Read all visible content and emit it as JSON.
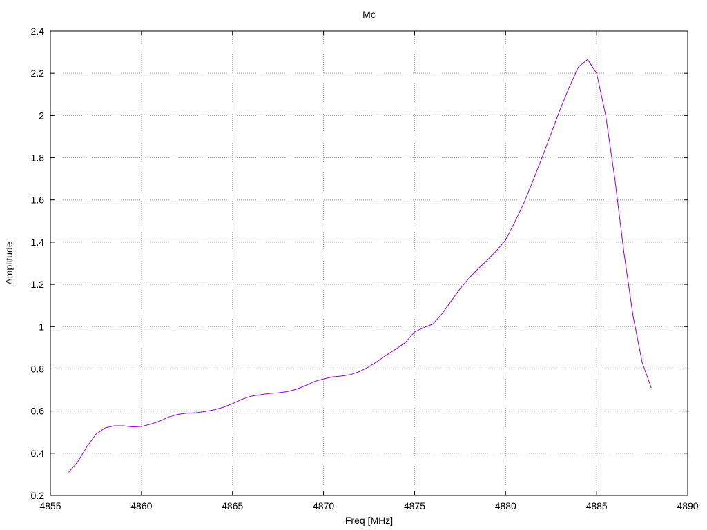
{
  "chart_data": {
    "type": "line",
    "title": "Mc",
    "xlabel": "Freq [MHz]",
    "ylabel": "Amplitude",
    "xlim": [
      4855,
      4890
    ],
    "ylim": [
      0.2,
      2.4
    ],
    "xticks": [
      4855,
      4860,
      4865,
      4870,
      4875,
      4880,
      4885,
      4890
    ],
    "yticks": [
      0.2,
      0.4,
      0.6,
      0.8,
      1,
      1.2,
      1.4,
      1.6,
      1.8,
      2,
      2.2,
      2.4
    ],
    "grid": true,
    "series": [
      {
        "color": "#9400d3",
        "x": [
          4856,
          4856.5,
          4857,
          4857.5,
          4858,
          4858.5,
          4859,
          4859.5,
          4860,
          4860.5,
          4861,
          4861.5,
          4862,
          4862.5,
          4863,
          4863.5,
          4864,
          4864.5,
          4865,
          4865.5,
          4866,
          4866.5,
          4867,
          4867.5,
          4868,
          4868.5,
          4869,
          4869.5,
          4870,
          4870.5,
          4871,
          4871.5,
          4872,
          4872.5,
          4873,
          4873.5,
          4874,
          4874.5,
          4875,
          4875.5,
          4876,
          4876.5,
          4877,
          4877.5,
          4878,
          4878.5,
          4879,
          4879.5,
          4880,
          4880.5,
          4881,
          4881.5,
          4882,
          4882.5,
          4883,
          4883.5,
          4884,
          4884.5,
          4885,
          4885.5,
          4886,
          4886.5,
          4887,
          4887.5,
          4888
        ],
        "y": [
          0.31,
          0.36,
          0.43,
          0.49,
          0.52,
          0.53,
          0.53,
          0.525,
          0.527,
          0.538,
          0.552,
          0.572,
          0.584,
          0.59,
          0.592,
          0.598,
          0.606,
          0.618,
          0.635,
          0.655,
          0.67,
          0.677,
          0.683,
          0.686,
          0.692,
          0.703,
          0.72,
          0.74,
          0.752,
          0.762,
          0.766,
          0.773,
          0.788,
          0.81,
          0.838,
          0.868,
          0.895,
          0.925,
          0.975,
          0.995,
          1.012,
          1.06,
          1.12,
          1.18,
          1.23,
          1.275,
          1.315,
          1.36,
          1.41,
          1.495,
          1.585,
          1.69,
          1.8,
          1.915,
          2.03,
          2.135,
          2.23,
          2.265,
          2.2,
          2.0,
          1.7,
          1.35,
          1.05,
          0.83,
          0.71
        ]
      }
    ]
  }
}
